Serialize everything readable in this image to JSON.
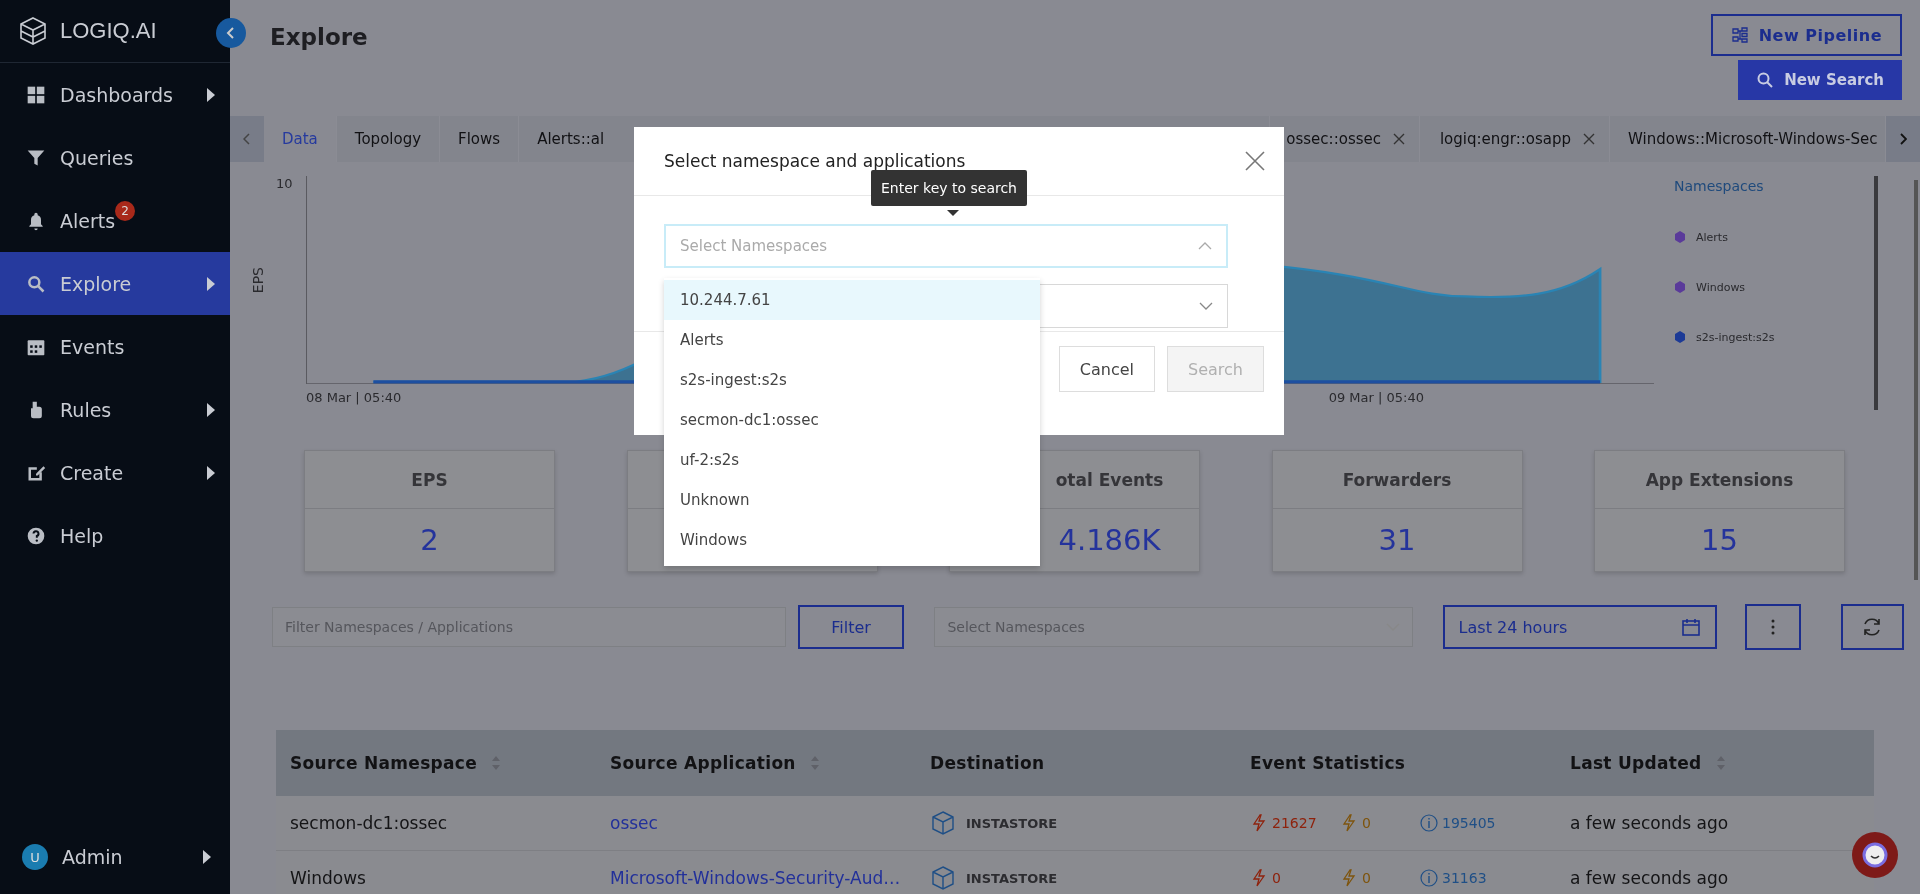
{
  "brand": {
    "name": "LOGIQ.AI"
  },
  "sidebar": {
    "items": [
      {
        "label": "Dashboards",
        "submenu": true,
        "selected": false
      },
      {
        "label": "Queries",
        "submenu": false,
        "selected": false
      },
      {
        "label": "Alerts",
        "submenu": false,
        "selected": false,
        "badge": "2"
      },
      {
        "label": "Explore",
        "submenu": true,
        "selected": true
      },
      {
        "label": "Events",
        "submenu": false,
        "selected": false
      },
      {
        "label": "Rules",
        "submenu": true,
        "selected": false
      },
      {
        "label": "Create",
        "submenu": true,
        "selected": false
      },
      {
        "label": "Help",
        "submenu": false,
        "selected": false
      }
    ],
    "user": {
      "avatar": "U",
      "name": "Admin"
    }
  },
  "page": {
    "title": "Explore"
  },
  "actions": {
    "new_pipeline": "New Pipeline",
    "new_search": "New Search"
  },
  "tabs": [
    {
      "label": "Data",
      "selected": true,
      "closable": false
    },
    {
      "label": "Topology",
      "selected": false,
      "closable": false
    },
    {
      "label": "Flows",
      "selected": false,
      "closable": false
    },
    {
      "label": "Alerts::al",
      "selected": false,
      "closable": false
    },
    {
      "label": "ossec::ossec",
      "selected": false,
      "closable": true
    },
    {
      "label": "logiq:engr::osapp",
      "selected": false,
      "closable": true
    },
    {
      "label": "Windows::Microsoft-Windows-Sec",
      "selected": false,
      "closable": false
    }
  ],
  "chart": {
    "ylabel": "EPS",
    "ytick": "10",
    "x_start": "08 Mar | 05:40",
    "x_end": "09 Mar | 05:40",
    "legend_title": "Namespaces",
    "legend": [
      {
        "name": "Alerts",
        "color": "#5a3a9a"
      },
      {
        "name": "Windows",
        "color": "#5a3a9a"
      },
      {
        "name": "s2s-ingest:s2s",
        "color": "#1c3a96"
      }
    ]
  },
  "stats": [
    {
      "kind": "stat",
      "label": "EPS",
      "value": "2"
    },
    {
      "kind": "blank"
    },
    {
      "kind": "stat",
      "label": "otal Events",
      "value": "4.186K"
    },
    {
      "kind": "stat",
      "label": "Forwarders",
      "value": "31"
    },
    {
      "kind": "stat",
      "label": "App Extensions",
      "value": "15"
    }
  ],
  "filters": {
    "search_placeholder": "Filter Namespaces / Applications",
    "filter_button": "Filter",
    "namespace_placeholder": "Select Namespaces",
    "time_range": "Last 24 hours"
  },
  "table": {
    "columns": [
      {
        "label": "Source Namespace",
        "sortable": true
      },
      {
        "label": "Source Application",
        "sortable": true
      },
      {
        "label": "Destination",
        "sortable": false
      },
      {
        "label": "Event Statistics",
        "sortable": false
      },
      {
        "label": "Last Updated",
        "sortable": true
      }
    ],
    "rows": [
      {
        "namespace": "secmon-dc1:ossec",
        "application": "ossec",
        "destination": "INSTASTORE",
        "errors": "21627",
        "warnings": "0",
        "info": "195405",
        "updated": "a few seconds ago"
      },
      {
        "namespace": "Windows",
        "application": "Microsoft-Windows-Security-Aud…",
        "destination": "INSTASTORE",
        "errors": "0",
        "warnings": "0",
        "info": "31163",
        "updated": "a few seconds ago"
      }
    ]
  },
  "modal": {
    "title": "Select namespace and applications",
    "tooltip": "Enter key to search",
    "namespace_placeholder": "Select Namespaces",
    "cancel": "Cancel",
    "search": "Search",
    "search_disabled": true,
    "options": [
      {
        "label": "10.244.7.61",
        "selected": true
      },
      {
        "label": "Alerts",
        "selected": false
      },
      {
        "label": "s2s-ingest:s2s",
        "selected": false
      },
      {
        "label": "secmon-dc1:ossec",
        "selected": false
      },
      {
        "label": "uf-2:s2s",
        "selected": false
      },
      {
        "label": "Unknown",
        "selected": false
      },
      {
        "label": "Windows",
        "selected": false
      }
    ]
  }
}
